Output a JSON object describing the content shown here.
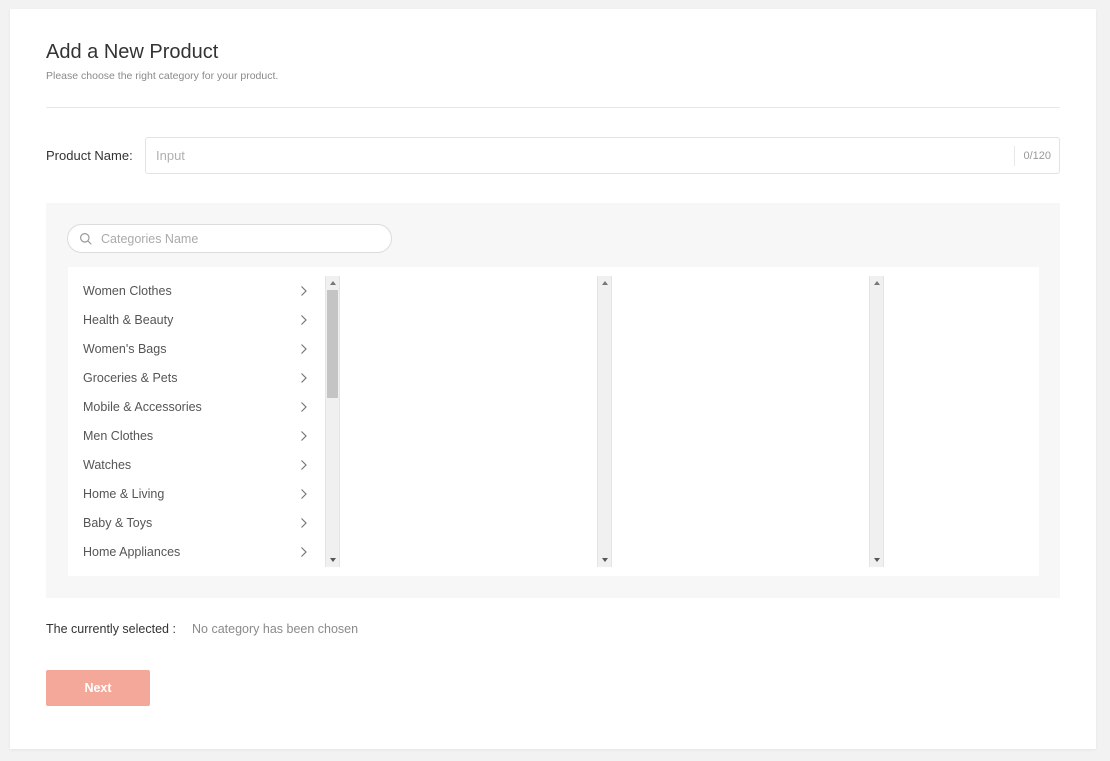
{
  "header": {
    "title": "Add a New Product",
    "subtitle": "Please choose the right category for your product."
  },
  "product_name": {
    "label": "Product Name:",
    "placeholder": "Input",
    "value": "",
    "char_count": "0/120"
  },
  "category_search": {
    "placeholder": "Categories Name",
    "icon": "search-icon"
  },
  "categories": [
    "Women Clothes",
    "Health & Beauty",
    "Women's Bags",
    "Groceries & Pets",
    "Mobile & Accessories",
    "Men Clothes",
    "Watches",
    "Home & Living",
    "Baby & Toys",
    "Home Appliances"
  ],
  "selection": {
    "label": "The currently selected :",
    "value": "No category has been chosen"
  },
  "actions": {
    "next_label": "Next"
  },
  "colors": {
    "accent_disabled": "#f4a89a",
    "panel_bg": "#f7f7f7"
  }
}
